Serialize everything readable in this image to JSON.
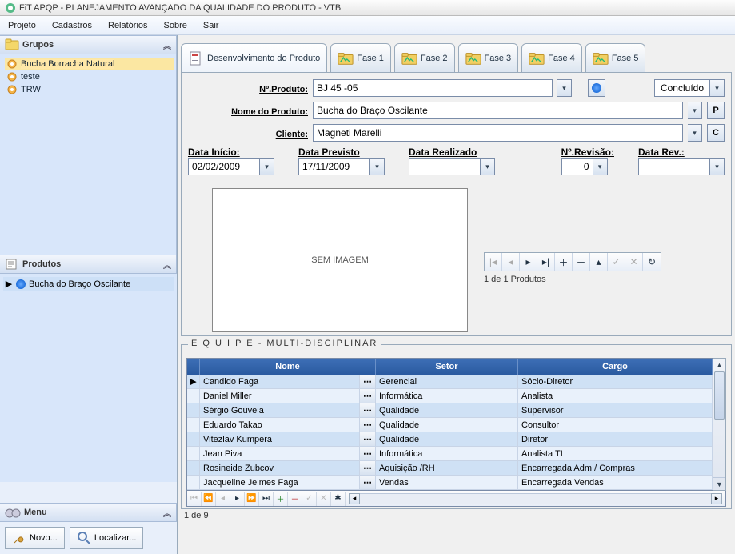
{
  "title": "FiT APQP - PLANEJAMENTO AVANÇADO DA QUALIDADE DO PRODUTO - VTB",
  "menu": {
    "projeto": "Projeto",
    "cadastros": "Cadastros",
    "relatorios": "Relatórios",
    "sobre": "Sobre",
    "sair": "Sair"
  },
  "sidebar": {
    "grupos_title": "Grupos",
    "grupos": [
      {
        "label": "Bucha Borracha Natural"
      },
      {
        "label": "teste"
      },
      {
        "label": "TRW"
      }
    ],
    "produtos_title": "Produtos",
    "produto_item": "Bucha do Braço Oscilante",
    "menu_title": "Menu",
    "novo": "Novo...",
    "localizar": "Localizar..."
  },
  "tabs": {
    "t0": "Desenvolvimento do Produto",
    "t1": "Fase 1",
    "t2": "Fase 2",
    "t3": "Fase 3",
    "t4": "Fase 4",
    "t5": "Fase 5"
  },
  "form": {
    "nproduto_lbl": "Nº.Produto:",
    "nproduto_val": "BJ 45 -05",
    "status": "Concluído",
    "nome_lbl": "Nome do Produto:",
    "nome_val": "Bucha do Braço Oscilante",
    "p_btn": "P",
    "cliente_lbl": "Cliente:",
    "cliente_val": "Magneti Marelli",
    "c_btn": "C",
    "data_inicio_lbl": "Data Início:",
    "data_inicio_val": "02/02/2009",
    "data_previsto_lbl": "Data Previsto",
    "data_previsto_val": "17/11/2009",
    "data_realizado_lbl": "Data Realizado",
    "data_realizado_val": "",
    "nrevisao_lbl": "Nº.Revisão:",
    "nrevisao_val": "0",
    "datarev_lbl": "Data Rev.:",
    "datarev_val": "",
    "sem_imagem": "SEM IMAGEM",
    "nav_caption": "1 de 1  Produtos"
  },
  "team": {
    "title": "E Q U I P E  - MULTI-DISCIPLINAR",
    "col_nome": "Nome",
    "col_setor": "Setor",
    "col_cargo": "Cargo",
    "rows": [
      {
        "nome": "Candido Faga",
        "setor": "Gerencial",
        "cargo": "Sócio-Diretor"
      },
      {
        "nome": "Daniel Miller",
        "setor": "Informática",
        "cargo": "Analista"
      },
      {
        "nome": "Sérgio Gouveia",
        "setor": "Qualidade",
        "cargo": "Supervisor"
      },
      {
        "nome": "Eduardo Takao",
        "setor": "Qualidade",
        "cargo": "Consultor"
      },
      {
        "nome": "Vitezlav Kumpera",
        "setor": "Qualidade",
        "cargo": "Diretor"
      },
      {
        "nome": "Jean Piva",
        "setor": "Informática",
        "cargo": "Analista TI"
      },
      {
        "nome": "Rosineide Zubcov",
        "setor": "Aquisição /RH",
        "cargo": "Encarregada Adm / Compras"
      },
      {
        "nome": "Jacqueline  Jeimes Faga",
        "setor": "Vendas",
        "cargo": "Encarregada Vendas"
      }
    ],
    "status": "1 de 9"
  }
}
